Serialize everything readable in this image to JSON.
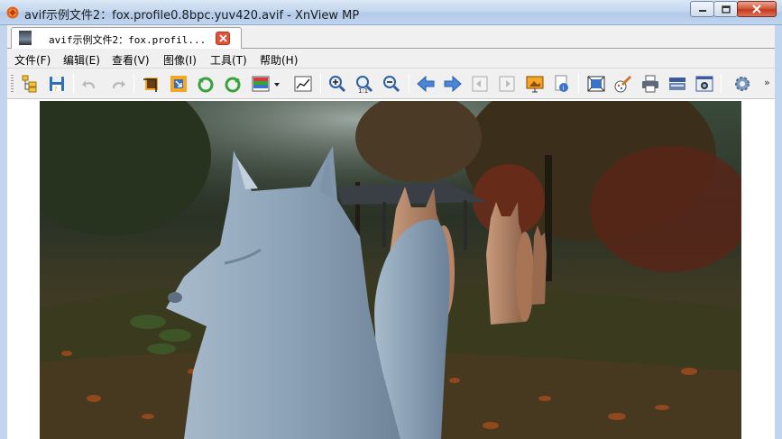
{
  "window": {
    "title": "avif示例文件2：fox.profile0.8bpc.yuv420.avif - XnView MP"
  },
  "tab": {
    "label": "avif示例文件2：fox.profil..."
  },
  "menu": {
    "items": [
      {
        "label": "文件(F)"
      },
      {
        "label": "编辑(E)"
      },
      {
        "label": "查看(V)"
      },
      {
        "label": "图像(I)"
      },
      {
        "label": "工具(T)"
      },
      {
        "label": "帮助(H)"
      }
    ]
  },
  "toolbar": {
    "overflow_glyph": "»",
    "icons": [
      "browser-icon",
      "save-icon",
      "undo-icon",
      "redo-icon",
      "crop-icon",
      "resize-icon",
      "rotate-left-icon",
      "rotate-right-icon",
      "adjust-colors-icon",
      "dropdown-arrow-icon",
      "levels-icon",
      "zoom-in-icon",
      "zoom-actual-icon",
      "zoom-out-icon",
      "previous-icon",
      "next-icon",
      "first-page-icon",
      "last-page-icon",
      "slideshow-icon",
      "properties-icon",
      "fit-screen-icon",
      "edit-paint-icon",
      "print-icon",
      "scanner-icon",
      "capture-icon",
      "settings-icon"
    ]
  },
  "colors": {
    "titlebar": "#c4d7ee",
    "close_button": "#c4391b",
    "chrome": "#f0f0f0",
    "accent_icon_blue": "#3a74c9"
  },
  "image": {
    "subject": "fox-statues-photo"
  }
}
